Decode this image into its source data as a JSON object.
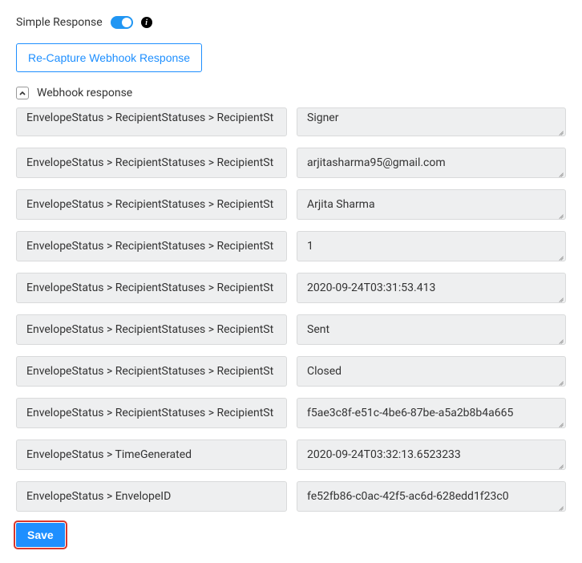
{
  "header": {
    "label": "Simple Response"
  },
  "recapture_button": "Re-Capture Webhook Response",
  "section_title": "Webhook response",
  "rows": [
    {
      "key": "EnvelopeStatus > RecipientStatuses > RecipientSt",
      "value": "Signer"
    },
    {
      "key": "EnvelopeStatus > RecipientStatuses > RecipientSt",
      "value": "arjitasharma95@gmail.com"
    },
    {
      "key": "EnvelopeStatus > RecipientStatuses > RecipientSt",
      "value": "Arjita Sharma"
    },
    {
      "key": "EnvelopeStatus > RecipientStatuses > RecipientSt",
      "value": "1"
    },
    {
      "key": "EnvelopeStatus > RecipientStatuses > RecipientSt",
      "value": "2020-09-24T03:31:53.413"
    },
    {
      "key": "EnvelopeStatus > RecipientStatuses > RecipientSt",
      "value": "Sent"
    },
    {
      "key": "EnvelopeStatus > RecipientStatuses > RecipientSt",
      "value": "Closed"
    },
    {
      "key": "EnvelopeStatus > RecipientStatuses > RecipientSt",
      "value": "f5ae3c8f-e51c-4be6-87be-a5a2b8b4a665"
    },
    {
      "key": "EnvelopeStatus > TimeGenerated",
      "value": "2020-09-24T03:32:13.6523233"
    },
    {
      "key": "EnvelopeStatus > EnvelopeID",
      "value": "fe52fb86-c0ac-42f5-ac6d-628edd1f23c0"
    }
  ],
  "save_button": "Save"
}
